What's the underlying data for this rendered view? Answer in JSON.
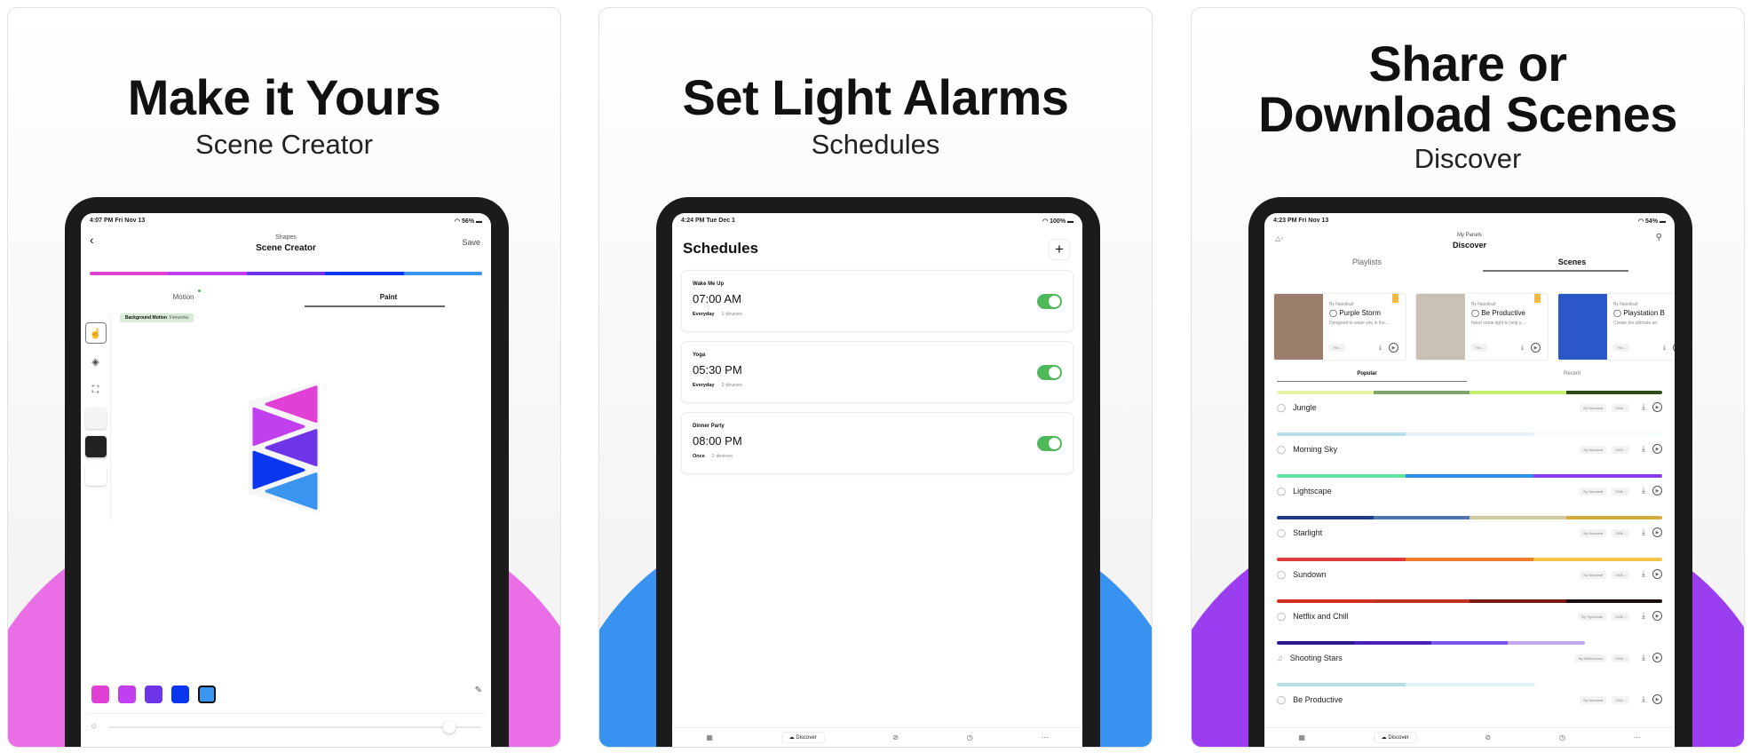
{
  "panels": [
    {
      "title": "Make it Yours",
      "subtitle": "Scene Creator",
      "accent": "#ea6fe6",
      "status": {
        "time": "4:07 PM  Fri Nov 13",
        "battery": "56%"
      },
      "header": {
        "overline": "Shapes",
        "title": "Scene Creator",
        "save": "Save"
      },
      "palette": [
        "#e040d6",
        "#c040f0",
        "#6e35e8",
        "#0a36f0",
        "#3a95f0"
      ],
      "tabs": [
        {
          "label": "Motion"
        },
        {
          "label": "Paint",
          "active": true
        }
      ],
      "chip": {
        "label": "Background Motion",
        "value": ": Fireworks"
      },
      "selected_swatch": 4,
      "brightness": 100
    },
    {
      "title": "Set Light Alarms",
      "subtitle": "Schedules",
      "accent": "#3892f0",
      "status": {
        "time": "4:24 PM  Tue Dec 1",
        "battery": "100%"
      },
      "page_title": "Schedules",
      "add": "+",
      "schedules": [
        {
          "name": "Wake Me Up",
          "time": "07:00 AM",
          "repeat": "Everyday",
          "devices": "1 devices",
          "enabled": true
        },
        {
          "name": "Yoga",
          "time": "05:30 PM",
          "repeat": "Everyday",
          "devices": "2 devices",
          "enabled": true
        },
        {
          "name": "Dinner Party",
          "time": "08:00 PM",
          "repeat": "Once",
          "devices": "2 devices",
          "enabled": true
        }
      ],
      "tabbar": {
        "discover": "Discover"
      }
    },
    {
      "title_line1": "Share or",
      "title_line2": "Download Scenes",
      "subtitle": "Discover",
      "accent": "#9b3ef0",
      "status": {
        "time": "4:23 PM  Fri Nov 13",
        "battery": "54%"
      },
      "header": {
        "overline": "My Panels",
        "title": "Discover"
      },
      "tabs": [
        {
          "label": "Playlists"
        },
        {
          "label": "Scenes",
          "active": true
        }
      ],
      "featured": [
        {
          "by": "By Nanoleaf",
          "name": "Purple Storm",
          "desc": "Designed to wake you in the...",
          "count": "79k ↓",
          "img": "#9c7e6d"
        },
        {
          "by": "By Nanoleaf",
          "name": "Be Productive",
          "desc": "Need some light to help y...",
          "count": "79k ↓",
          "img": "#c9c1b5"
        },
        {
          "by": "By Nanoleaf",
          "name": "Playstation B",
          "desc": "Create the ultimate an",
          "count": "79k ↓",
          "img": "#2b58c8"
        }
      ],
      "subtabs": [
        {
          "label": "Popular",
          "active": true
        },
        {
          "label": "Recent"
        }
      ],
      "scenes": [
        {
          "name": "Jungle",
          "icon": "drop",
          "author": "By Nanoleaf",
          "downloads": "253k ↓",
          "colors": [
            "#e6f7a8",
            "#7fa36a",
            "#c5ef6e",
            "#2d4a17"
          ]
        },
        {
          "name": "Morning Sky",
          "icon": "drop",
          "author": "By Nanoleaf",
          "downloads": "253k ↓",
          "colors": [
            "#b6dde9",
            "#e4f3f8",
            "#f6fbfd"
          ]
        },
        {
          "name": "Lightscape",
          "icon": "drop",
          "author": "By Nanoleaf",
          "downloads": "253k ↓",
          "colors": [
            "#5fe3a1",
            "#2f8ee8",
            "#8a3cf0"
          ]
        },
        {
          "name": "Starlight",
          "icon": "drop",
          "author": "By Nanoleaf",
          "downloads": "253k ↓",
          "colors": [
            "#1f3a8a",
            "#4f74b0",
            "#cfc8a0",
            "#d2ac3a"
          ]
        },
        {
          "name": "Sundown",
          "icon": "drop",
          "author": "By Nanoleaf",
          "downloads": "253k ↓",
          "colors": [
            "#e03a3a",
            "#ef7d2d",
            "#f5c24a"
          ]
        },
        {
          "name": "Netflix and Chill",
          "icon": "drop",
          "author": "By Tigerkwan",
          "downloads": "253k ↓",
          "colors": [
            "#d2301f",
            "#c0301f",
            "#7a1a14",
            "#1a0d0d"
          ]
        },
        {
          "name": "Shooting Stars",
          "icon": "music",
          "author": "By AllMonGods",
          "downloads": "253k ↓",
          "colors": [
            "#2b1a8c",
            "#4a1fb8",
            "#7a55ec",
            "#c4a8f0"
          ]
        },
        {
          "name": "Be Productive",
          "icon": "drop",
          "author": "By Nanoleaf",
          "downloads": "253k ↓",
          "colors": [
            "#b6dde9",
            "#e4f3f8"
          ]
        }
      ],
      "tabbar": {
        "discover": "Discover"
      }
    }
  ]
}
